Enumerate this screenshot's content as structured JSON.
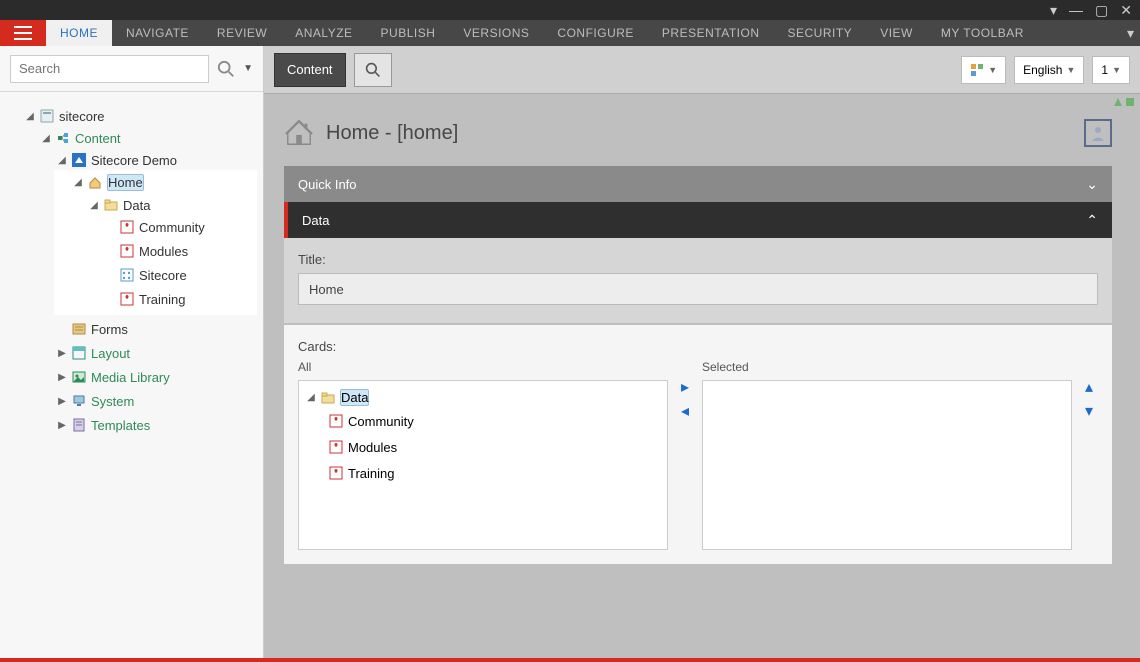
{
  "titlebar": {},
  "ribbon": {
    "tabs": [
      {
        "label": "HOME",
        "active": true
      },
      {
        "label": "NAVIGATE"
      },
      {
        "label": "REVIEW"
      },
      {
        "label": "ANALYZE"
      },
      {
        "label": "PUBLISH"
      },
      {
        "label": "VERSIONS"
      },
      {
        "label": "CONFIGURE"
      },
      {
        "label": "PRESENTATION"
      },
      {
        "label": "SECURITY"
      },
      {
        "label": "VIEW"
      },
      {
        "label": "MY TOOLBAR"
      }
    ]
  },
  "search": {
    "placeholder": "Search"
  },
  "tree": {
    "root": "sitecore",
    "content": "Content",
    "demo": "Sitecore Demo",
    "home": "Home",
    "data": "Data",
    "data_children": [
      "Community",
      "Modules",
      "Sitecore",
      "Training"
    ],
    "forms": "Forms",
    "layout": "Layout",
    "media": "Media Library",
    "system": "System",
    "templates": "Templates"
  },
  "right_toolbar": {
    "content_btn": "Content",
    "language": "English",
    "version": "1"
  },
  "page": {
    "title": "Home - [home]"
  },
  "sections": {
    "quick": "Quick Info",
    "data": "Data"
  },
  "fields": {
    "title_label": "Title:",
    "title_value": "Home",
    "cards_label": "Cards:",
    "all_label": "All",
    "selected_label": "Selected",
    "all_root": "Data",
    "all_items": [
      "Community",
      "Modules",
      "Training"
    ]
  }
}
